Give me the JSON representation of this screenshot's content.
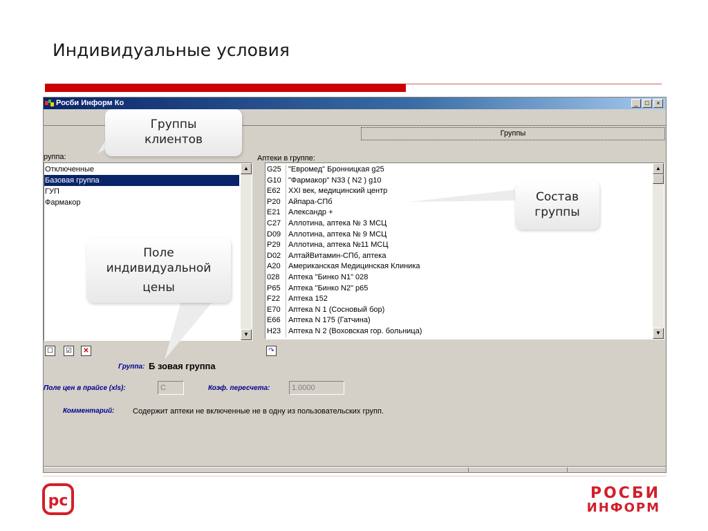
{
  "slide": {
    "title": "Индивидуальные условия",
    "accent_color": "#cc0000"
  },
  "window": {
    "title": "Росби Информ Ко",
    "buttons": {
      "minimize": "_",
      "maximize": "□",
      "close": "×"
    },
    "group_tab_label": "Группы"
  },
  "groups_panel": {
    "label": "руппа:",
    "items": [
      {
        "label": "Отключенные",
        "selected": false
      },
      {
        "label": "Базовая группа",
        "selected": true
      },
      {
        "label": "ГУП",
        "selected": false
      },
      {
        "label": "Фармакор",
        "selected": false
      }
    ]
  },
  "pharmacies_panel": {
    "label": "Аптеки в группе:",
    "rows": [
      {
        "code": "G25",
        "name": "\"Евромед\" Бронницкая g25"
      },
      {
        "code": "G10",
        "name": "\"Фармакор\" N33 ( N2 ) g10"
      },
      {
        "code": "E62",
        "name": "XXI век, медицинский центр"
      },
      {
        "code": "P20",
        "name": "Айпара-СПб"
      },
      {
        "code": "E21",
        "name": "Александр +"
      },
      {
        "code": "C27",
        "name": "Аллотина, аптека № 3 МСЦ"
      },
      {
        "code": "D09",
        "name": "Аллотина, аптека № 9 МСЦ"
      },
      {
        "code": "P29",
        "name": "Аллотина, аптека №11 МСЦ"
      },
      {
        "code": "D02",
        "name": "АлтайВитамин-СПб, аптека"
      },
      {
        "code": "A20",
        "name": "Американская Медицинская Клиника"
      },
      {
        "code": "028",
        "name": "Аптека \"Бинко N1\" 028"
      },
      {
        "code": "P65",
        "name": "Аптека \"Бинко N2\" p65"
      },
      {
        "code": "F22",
        "name": "Аптека 152"
      },
      {
        "code": "E70",
        "name": "Аптека N 1 (Сосновый бор)"
      },
      {
        "code": "E66",
        "name": "Аптека N 175 (Гатчина)"
      },
      {
        "code": "H23",
        "name": "Аптека N 2 (Воховская гор. больница)"
      }
    ]
  },
  "toolbar_icons": {
    "new": "☐",
    "check": "☑",
    "delete": "✕",
    "refresh": "↷"
  },
  "details": {
    "group_label": "Группа:",
    "group_value": "Б зовая группа",
    "price_field_label": "Поле цен в прайсе (xls):",
    "price_field_value": "C",
    "coef_label": "Коэф. пересчета:",
    "coef_value": "1.0000",
    "comment_label": "Комментарий:",
    "comment_value": "Содержит аптеки не включенные не в одну из пользовательских групп."
  },
  "callouts": {
    "groups": [
      "Группы",
      "клиентов"
    ],
    "composition": [
      "Состав",
      "группы"
    ],
    "price_field": [
      "Поле",
      "индивидуальной",
      "цены"
    ]
  },
  "logo": {
    "left_mark": "рс",
    "right_line1": "РОСБИ",
    "right_line2": "ИНФОРМ",
    "brand_color": "#d21f2a"
  }
}
